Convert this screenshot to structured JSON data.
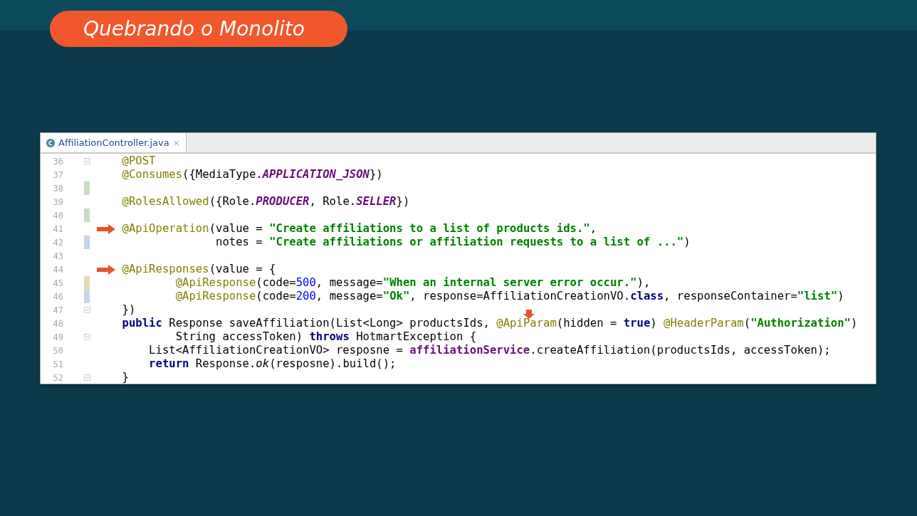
{
  "slide_title": "Quebrando o Monolito",
  "editor": {
    "tab": {
      "label": "AffiliationController.java",
      "close": "×",
      "selected": true
    },
    "lines": [
      {
        "n": "36",
        "fold": true,
        "tokens": [
          {
            "kind": "ann",
            "text": "    @POST"
          }
        ]
      },
      {
        "n": "37",
        "tokens": [
          {
            "kind": "ann",
            "text": "    @Consumes"
          },
          {
            "kind": "plain",
            "text": "({MediaType."
          },
          {
            "kind": "const",
            "text": "APPLICATION_JSON"
          },
          {
            "kind": "plain",
            "text": "})"
          }
        ]
      },
      {
        "n": "38",
        "color": "#c8dcc4"
      },
      {
        "n": "39",
        "tokens": [
          {
            "kind": "ann",
            "text": "    @RolesAllowed"
          },
          {
            "kind": "plain",
            "text": "({Role."
          },
          {
            "kind": "const",
            "text": "PRODUCER"
          },
          {
            "kind": "plain",
            "text": ", Role."
          },
          {
            "kind": "const",
            "text": "SELLER"
          },
          {
            "kind": "plain",
            "text": "})"
          }
        ]
      },
      {
        "n": "40",
        "color": "#c8dcc4"
      },
      {
        "n": "41",
        "arrow": true,
        "tokens": [
          {
            "kind": "ann",
            "text": "    @ApiOperation"
          },
          {
            "kind": "plain",
            "text": "(value = "
          },
          {
            "kind": "str",
            "text": "\"Create affiliations to a list of products ids.\""
          },
          {
            "kind": "plain",
            "text": ","
          }
        ]
      },
      {
        "n": "42",
        "color": "#c4d4ea",
        "tokens": [
          {
            "kind": "plain",
            "text": "                  notes = "
          },
          {
            "kind": "str",
            "text": "\"Create affiliations or affiliation requests to a list of ...\""
          },
          {
            "kind": "plain",
            "text": ")"
          }
        ]
      },
      {
        "n": "43"
      },
      {
        "n": "44",
        "arrow": true,
        "tokens": [
          {
            "kind": "ann",
            "text": "    @ApiResponses"
          },
          {
            "kind": "plain",
            "text": "(value = {"
          }
        ]
      },
      {
        "n": "45",
        "color": "#e8d9b4",
        "tokens": [
          {
            "kind": "ann",
            "text": "            @ApiResponse"
          },
          {
            "kind": "plain",
            "text": "(code="
          },
          {
            "kind": "num",
            "text": "500"
          },
          {
            "kind": "plain",
            "text": ", message="
          },
          {
            "kind": "str",
            "text": "\"When an internal server error occur.\""
          },
          {
            "kind": "plain",
            "text": "),"
          }
        ]
      },
      {
        "n": "46",
        "color": "#c4d4ea",
        "tokens": [
          {
            "kind": "ann",
            "text": "            @ApiResponse"
          },
          {
            "kind": "plain",
            "text": "(code="
          },
          {
            "kind": "num",
            "text": "200"
          },
          {
            "kind": "plain",
            "text": ", message="
          },
          {
            "kind": "str",
            "text": "\"Ok\""
          },
          {
            "kind": "plain",
            "text": ", response=AffiliationCreationVO."
          },
          {
            "kind": "kw",
            "text": "class"
          },
          {
            "kind": "plain",
            "text": ", responseContainer="
          },
          {
            "kind": "str",
            "text": "\"list\""
          },
          {
            "kind": "plain",
            "text": ")"
          }
        ]
      },
      {
        "n": "47",
        "fold": true,
        "tokens": [
          {
            "kind": "plain",
            "text": "    })"
          }
        ]
      },
      {
        "n": "48",
        "tokens": [
          {
            "kind": "kw",
            "text": "    public"
          },
          {
            "kind": "plain",
            "text": " Response saveAffiliation(List<Long> productsIds, "
          },
          {
            "kind": "ann",
            "text": "@ApiParam",
            "pointed": true
          },
          {
            "kind": "plain",
            "text": "(hidden = "
          },
          {
            "kind": "kw",
            "text": "true"
          },
          {
            "kind": "plain",
            "text": ") "
          },
          {
            "kind": "ann",
            "text": "@HeaderParam"
          },
          {
            "kind": "plain",
            "text": "("
          },
          {
            "kind": "str",
            "text": "\"Authorization\""
          },
          {
            "kind": "plain",
            "text": ")"
          }
        ]
      },
      {
        "n": "49",
        "fold": true,
        "tokens": [
          {
            "kind": "plain",
            "text": "            String accessToken) "
          },
          {
            "kind": "kw",
            "text": "throws"
          },
          {
            "kind": "plain",
            "text": " HotmartException {"
          }
        ]
      },
      {
        "n": "50",
        "tokens": [
          {
            "kind": "plain",
            "text": "        List<AffiliationCreationVO> resposne = "
          },
          {
            "kind": "field",
            "text": "affiliationService"
          },
          {
            "kind": "plain",
            "text": ".createAffiliation(productsIds, accessToken);"
          }
        ]
      },
      {
        "n": "51",
        "tokens": [
          {
            "kind": "kw",
            "text": "        return"
          },
          {
            "kind": "plain",
            "text": " Response."
          },
          {
            "kind": "italic",
            "text": "ok"
          },
          {
            "kind": "plain",
            "text": "(resposne).build();"
          }
        ]
      },
      {
        "n": "52",
        "fold": true,
        "tokens": [
          {
            "kind": "plain",
            "text": "    }"
          }
        ]
      }
    ]
  }
}
